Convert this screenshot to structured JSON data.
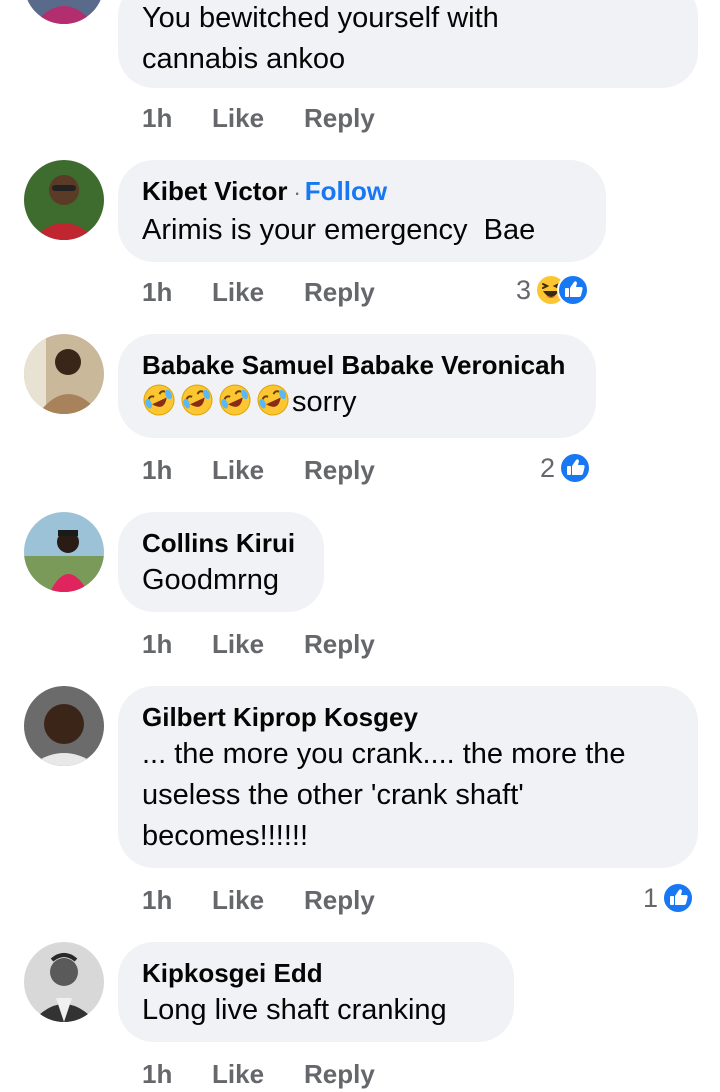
{
  "comments": [
    {
      "id": "c1",
      "name": "",
      "text_lines": [
        "You bewitched yourself with",
        "cannabis ankoo"
      ],
      "time": "1h",
      "like": "Like",
      "reply": "Reply",
      "reaction_count": ""
    },
    {
      "id": "c2",
      "name": "Kibet Victor",
      "separator": "·",
      "follow": "Follow",
      "text_lines": [
        "Arimis is your emergency  Bae"
      ],
      "time": "1h",
      "like": "Like",
      "reply": "Reply",
      "reaction_count": "3",
      "reactions": [
        "haha-icon",
        "like-icon"
      ]
    },
    {
      "id": "c3",
      "name": "Babake Samuel Babake Veronicah",
      "emoji_prefix": [
        "rolling-laughing-emoji",
        "rolling-laughing-emoji",
        "rolling-laughing-emoji",
        "rolling-laughing-emoji"
      ],
      "text_lines": [
        "sorry"
      ],
      "time": "1h",
      "like": "Like",
      "reply": "Reply",
      "reaction_count": "2",
      "reactions": [
        "like-icon"
      ]
    },
    {
      "id": "c4",
      "name": "Collins Kirui",
      "text_lines": [
        "Goodmrng"
      ],
      "time": "1h",
      "like": "Like",
      "reply": "Reply",
      "reaction_count": ""
    },
    {
      "id": "c5",
      "name": "Gilbert Kiprop Kosgey",
      "text_lines": [
        "... the more you crank.... the more the",
        "useless the other 'crank shaft'",
        "becomes!!!!!!"
      ],
      "time": "1h",
      "like": "Like",
      "reply": "Reply",
      "reaction_count": "1",
      "reactions": [
        "like-icon"
      ]
    },
    {
      "id": "c6",
      "name": "Kipkosgei Edd",
      "text_lines": [
        "Long live shaft cranking"
      ],
      "time": "1h",
      "like": "Like",
      "reply": "Reply",
      "reaction_count": ""
    }
  ],
  "colors": {
    "bubble": "#f0f2f5",
    "meta": "#65676b",
    "accent": "#1877f2",
    "text": "#050505"
  }
}
